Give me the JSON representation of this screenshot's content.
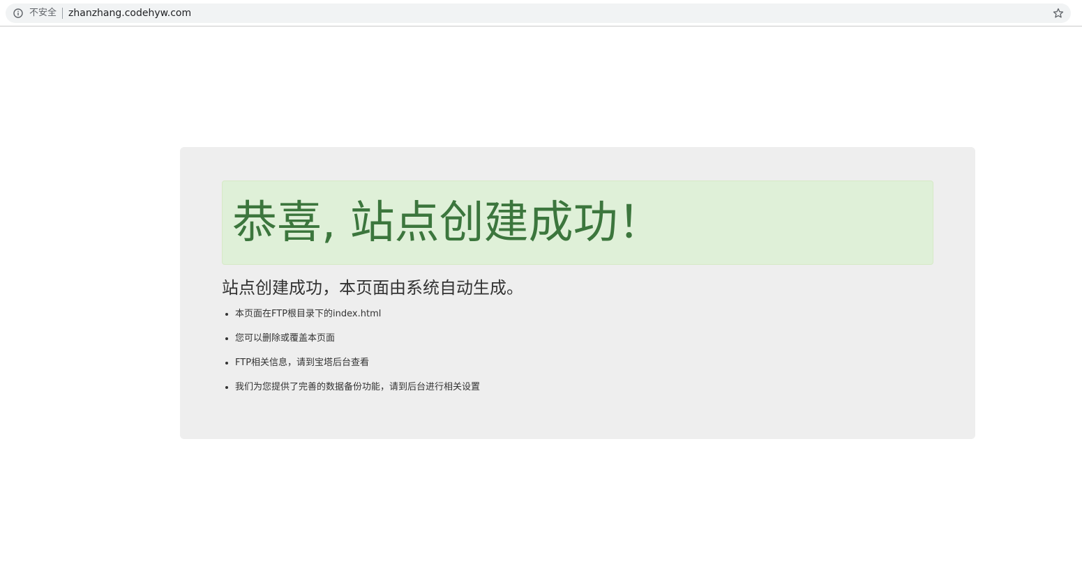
{
  "browser": {
    "security_label": "不安全",
    "url": "zhanzhang.codehyw.com",
    "info_icon": "info-icon",
    "bookmark_icon": "star-icon"
  },
  "page": {
    "heading": "恭喜, 站点创建成功！",
    "subtitle": "站点创建成功，本页面由系统自动生成。",
    "items": [
      "本页面在FTP根目录下的index.html",
      "您可以删除或覆盖本页面",
      "FTP相关信息，请到宝塔后台查看",
      "我们为您提供了完善的数据备份功能，请到后台进行相关设置"
    ]
  },
  "colors": {
    "panel_bg": "#eeeeee",
    "alert_bg": "#dff0d8",
    "alert_text": "#3c763d",
    "body_text": "#333333"
  }
}
